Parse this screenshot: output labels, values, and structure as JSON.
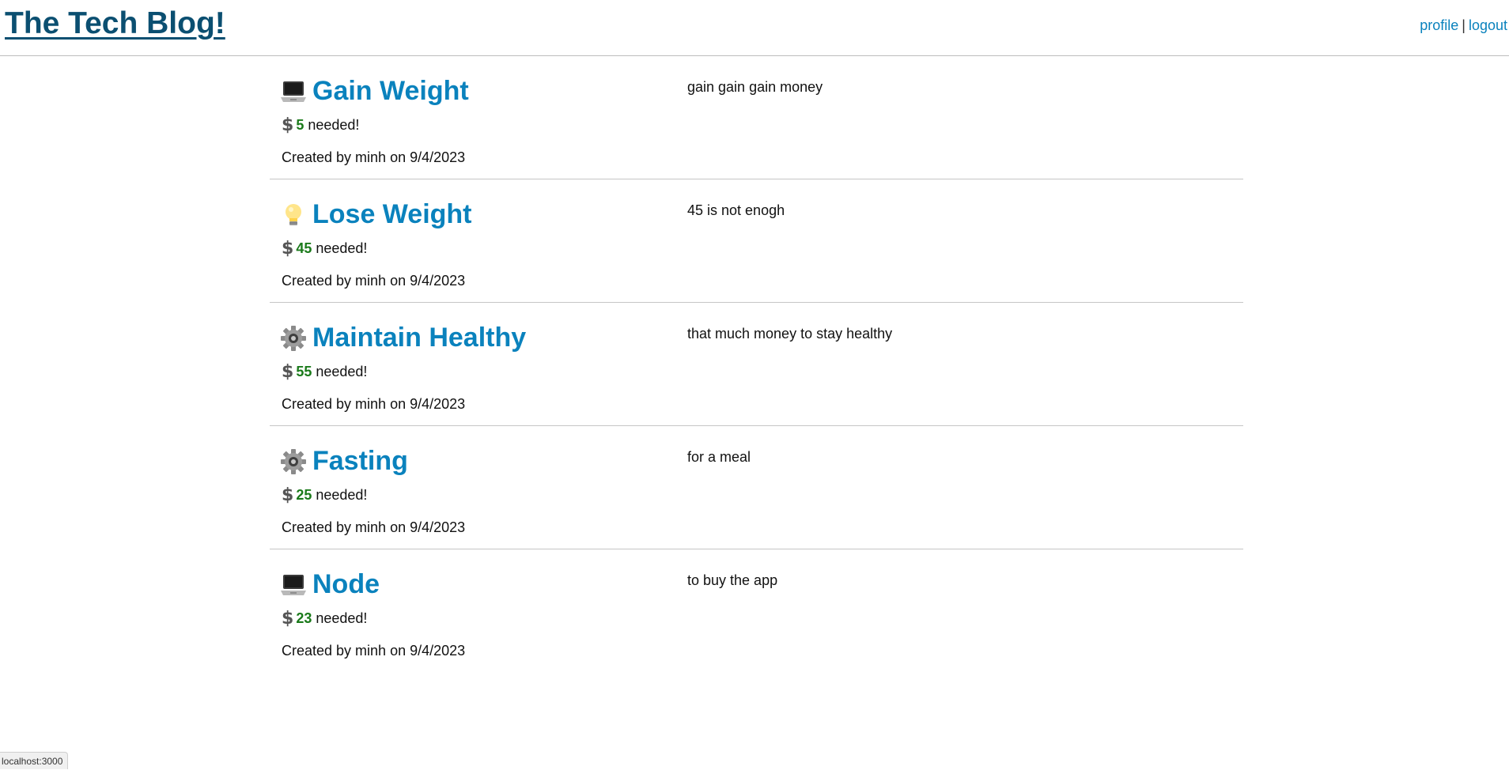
{
  "header": {
    "brand": "The Tech Blog!",
    "nav": {
      "profile": "profile",
      "separator": "|",
      "logout": "logout"
    }
  },
  "posts": [
    {
      "icon": "laptop-icon",
      "title": "Gain Weight",
      "currency_symbol": "$",
      "amount": "5",
      "needed_text": "needed!",
      "meta": "Created by minh on 9/4/2023",
      "description": "gain gain gain money"
    },
    {
      "icon": "lightbulb-icon",
      "title": "Lose Weight",
      "currency_symbol": "$",
      "amount": "45",
      "needed_text": "needed!",
      "meta": "Created by minh on 9/4/2023",
      "description": "45 is not enogh"
    },
    {
      "icon": "gear-icon",
      "title": "Maintain Healthy",
      "currency_symbol": "$",
      "amount": "55",
      "needed_text": "needed!",
      "meta": "Created by minh on 9/4/2023",
      "description": "that much money to stay healthy"
    },
    {
      "icon": "gear-icon",
      "title": "Fasting",
      "currency_symbol": "$",
      "amount": "25",
      "needed_text": "needed!",
      "meta": "Created by minh on 9/4/2023",
      "description": "for a meal"
    },
    {
      "icon": "laptop-icon",
      "title": "Node",
      "currency_symbol": "$",
      "amount": "23",
      "needed_text": "needed!",
      "meta": "Created by minh on 9/4/2023",
      "description": "to buy the app"
    }
  ],
  "status_bar": {
    "url": "localhost:3000"
  },
  "colors": {
    "brand": "#0b4f71",
    "link": "#0a82bd",
    "amount": "#1a7a1a"
  }
}
